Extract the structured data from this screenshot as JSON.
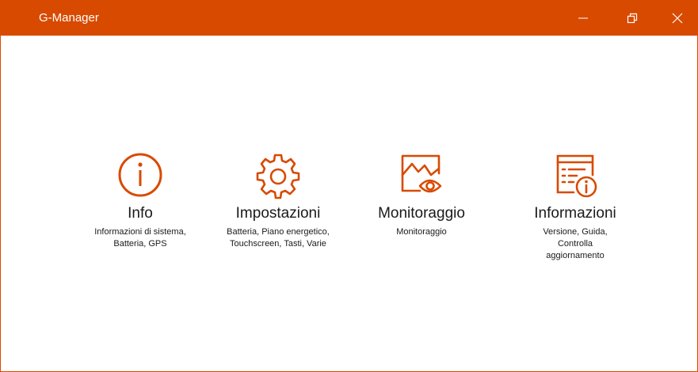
{
  "window": {
    "title": "G-Manager",
    "accent_color": "#d84a00",
    "controls": {
      "minimize_icon": "minimize-icon",
      "restore_icon": "restore-icon",
      "close_icon": "close-icon"
    }
  },
  "tiles": [
    {
      "icon": "info-icon",
      "title": "Info",
      "subtitle": "Informazioni di sistema, Batteria, GPS"
    },
    {
      "icon": "gear-icon",
      "title": "Impostazioni",
      "subtitle": "Batteria, Piano energetico, Touchscreen, Tasti, Varie"
    },
    {
      "icon": "monitor-eye-icon",
      "title": "Monitoraggio",
      "subtitle": "Monitoraggio"
    },
    {
      "icon": "document-info-icon",
      "title": "Informazioni",
      "subtitle": "Versione, Guida, Controlla aggiornamento"
    }
  ]
}
